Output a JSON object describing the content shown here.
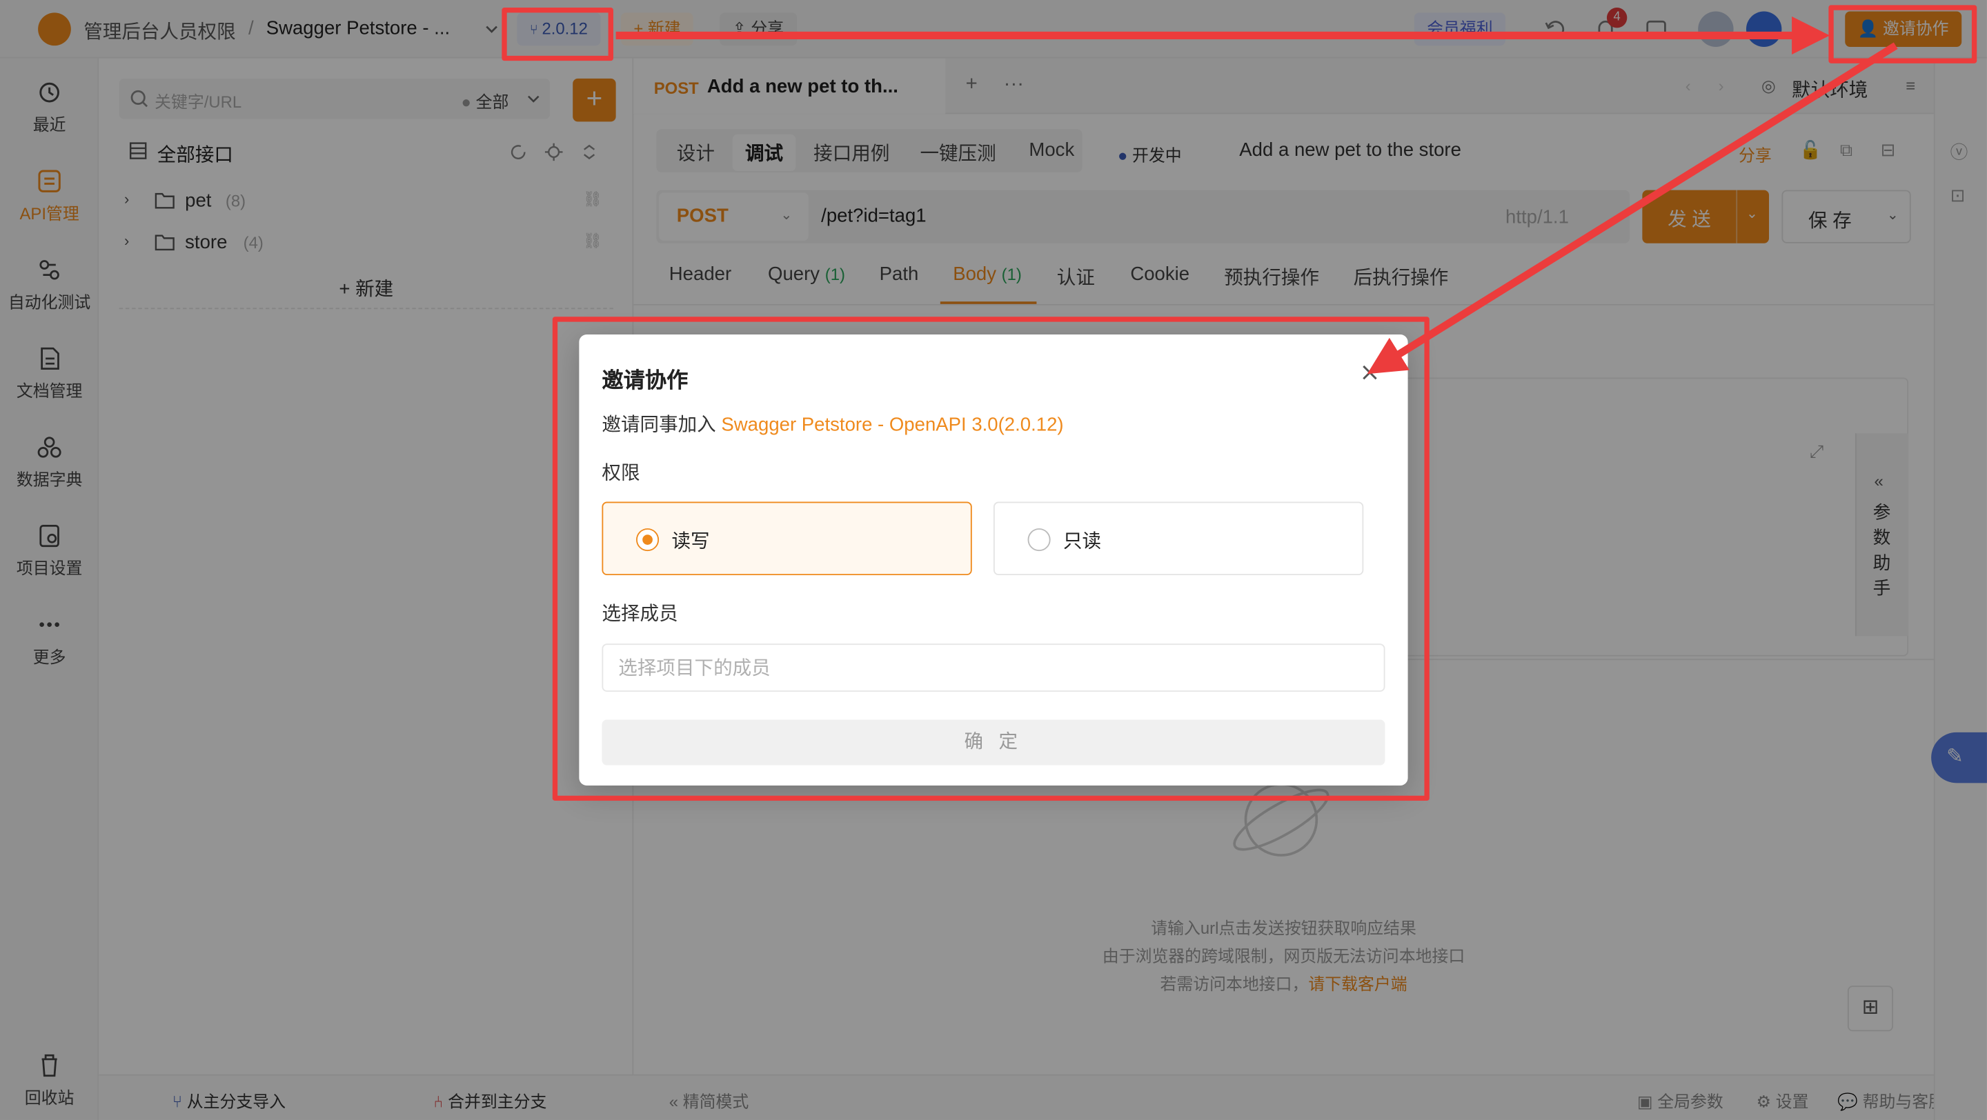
{
  "app": {
    "project_crumb": "管理后台人员权限",
    "separator": "/",
    "project_name": "Swagger Petstore - ...",
    "version_badge": "2.0.12",
    "new_label": "+ 新建",
    "share_label": "分享",
    "member_promo": "会员福利",
    "notification_count": "4",
    "invite_button": "邀请协作"
  },
  "leftnav": {
    "items": [
      {
        "label": "最近",
        "icon": "history-icon"
      },
      {
        "label": "API管理",
        "icon": "api-management-icon"
      },
      {
        "label": "自动化测试",
        "icon": "automation-test-icon"
      },
      {
        "label": "文档管理",
        "icon": "document-icon"
      },
      {
        "label": "数据字典",
        "icon": "data-dictionary-icon"
      },
      {
        "label": "项目设置",
        "icon": "project-settings-icon"
      },
      {
        "label": "更多",
        "icon": "more-icon"
      }
    ],
    "recycle": "回收站"
  },
  "tree": {
    "search_placeholder": "关键字/URL",
    "filter": "全部",
    "root": "全部接口",
    "folders": [
      {
        "name": "pet",
        "count": "(8)"
      },
      {
        "name": "store",
        "count": "(4)"
      }
    ],
    "new_label": "新建",
    "footer_import": "从主分支导入",
    "footer_merge": "合并到主分支"
  },
  "editor": {
    "tab_method": "POST",
    "tab_title": "Add a new pet to th...",
    "env": "默认环境",
    "modes": [
      "设计",
      "调试",
      "接口用例",
      "一键压测",
      "Mock"
    ],
    "status": "开发中",
    "api_name": "Add a new pet to the store",
    "share": "分享",
    "method": "POST",
    "url": "/pet?id=tag1",
    "protocol": "http/1.1",
    "send": "发 送",
    "save": "保 存",
    "param_tabs": [
      {
        "label": "Header",
        "count": ""
      },
      {
        "label": "Query",
        "count": "(1)"
      },
      {
        "label": "Path",
        "count": ""
      },
      {
        "label": "Body",
        "count": "(1)"
      },
      {
        "label": "认证",
        "count": ""
      },
      {
        "label": "Cookie",
        "count": ""
      },
      {
        "label": "预执行操作",
        "count": ""
      },
      {
        "label": "后执行操作",
        "count": ""
      }
    ],
    "helper_label": "参数助手",
    "hint_line1": "请输入url点击发送按钮获取响应结果",
    "hint_line2": "由于浏览器的跨域限制，网页版无法访问本地接口",
    "hint_line3": "若需访问本地接口，",
    "hint_link": "请下载客户端",
    "footer_mode": "精简模式",
    "footer_params": "全局参数",
    "footer_settings": "设置",
    "footer_help": "帮助与客服"
  },
  "modal": {
    "title": "邀请协作",
    "subtitle_prefix": "邀请同事加入 ",
    "subtitle_project": "Swagger Petstore - OpenAPI 3.0(2.0.12)",
    "permission_label": "权限",
    "option_rw": "读写",
    "option_ro": "只读",
    "selected_option": "读写",
    "member_label": "选择成员",
    "member_placeholder": "选择项目下的成员",
    "confirm": "确 定"
  },
  "colors": {
    "accent": "#ef8a1d",
    "annotation_red": "#ec3c3c",
    "count_green": "#2aa55a"
  }
}
